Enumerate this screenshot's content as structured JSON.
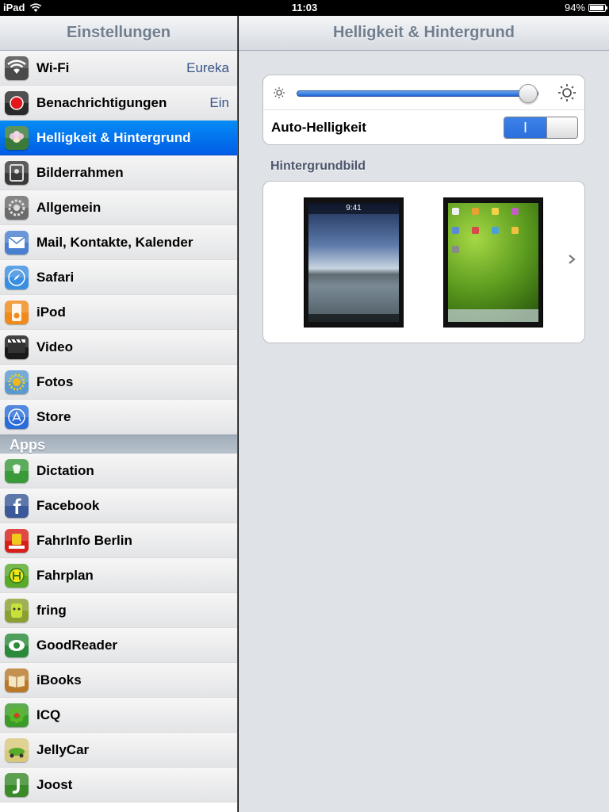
{
  "status_bar": {
    "device": "iPad",
    "time": "11:03",
    "battery": "94%",
    "battery_level": 0.94
  },
  "sidebar": {
    "title": "Einstellungen",
    "items": [
      {
        "label": "Wi-Fi",
        "value": "Eureka",
        "icon": "wifi-icon",
        "color": "#4a4a4a"
      },
      {
        "label": "Benachrichtigungen",
        "value": "Ein",
        "icon": "notifications-icon",
        "color": "#2a2a2a"
      },
      {
        "label": "Helligkeit & Hintergrund",
        "value": "",
        "icon": "brightness-wallpaper-icon",
        "color": "#3a7a3a",
        "selected": true
      },
      {
        "label": "Bilderrahmen",
        "value": "",
        "icon": "picture-frame-icon",
        "color": "#3a3a3a"
      },
      {
        "label": "Allgemein",
        "value": "",
        "icon": "gear-icon",
        "color": "#6b6b6b"
      },
      {
        "label": "Mail, Kontakte, Kalender",
        "value": "",
        "icon": "mail-icon",
        "color": "#4a7fd0"
      },
      {
        "label": "Safari",
        "value": "",
        "icon": "safari-icon",
        "color": "#3a8ee0"
      },
      {
        "label": "iPod",
        "value": "",
        "icon": "ipod-icon",
        "color": "#f08a1a"
      },
      {
        "label": "Video",
        "value": "",
        "icon": "video-icon",
        "color": "#1a1a1a"
      },
      {
        "label": "Fotos",
        "value": "",
        "icon": "photos-icon",
        "color": "#5a9ad0"
      },
      {
        "label": "Store",
        "value": "",
        "icon": "app-store-icon",
        "color": "#2a6dd8"
      }
    ],
    "apps_header": "Apps",
    "apps": [
      {
        "label": "Dictation",
        "icon": "dragon-dictation-icon",
        "color": "#3a9a3a"
      },
      {
        "label": "Facebook",
        "icon": "facebook-icon",
        "color": "#3b5998"
      },
      {
        "label": "FahrInfo Berlin",
        "icon": "fahrinfo-icon",
        "color": "#d8201a"
      },
      {
        "label": "Fahrplan",
        "icon": "fahrplan-icon",
        "color": "#5aaa2a"
      },
      {
        "label": "fring",
        "icon": "fring-icon",
        "color": "#8aa030"
      },
      {
        "label": "GoodReader",
        "icon": "goodreader-icon",
        "color": "#2a8a3a"
      },
      {
        "label": "iBooks",
        "icon": "ibooks-icon",
        "color": "#b87a2a"
      },
      {
        "label": "ICQ",
        "icon": "icq-icon",
        "color": "#3a9a2a"
      },
      {
        "label": "JellyCar",
        "icon": "jellycar-icon",
        "color": "#d8c87a"
      },
      {
        "label": "Joost",
        "icon": "joost-icon",
        "color": "#3a8a2a"
      }
    ]
  },
  "detail": {
    "title": "Helligkeit & Hintergrund",
    "brightness_level": 0.95,
    "auto_brightness_label": "Auto-Helligkeit",
    "auto_brightness_on": true,
    "toggle_on_glyph": "I",
    "wallpaper_section_title": "Hintergrundbild",
    "lock_clock": "9:41"
  }
}
